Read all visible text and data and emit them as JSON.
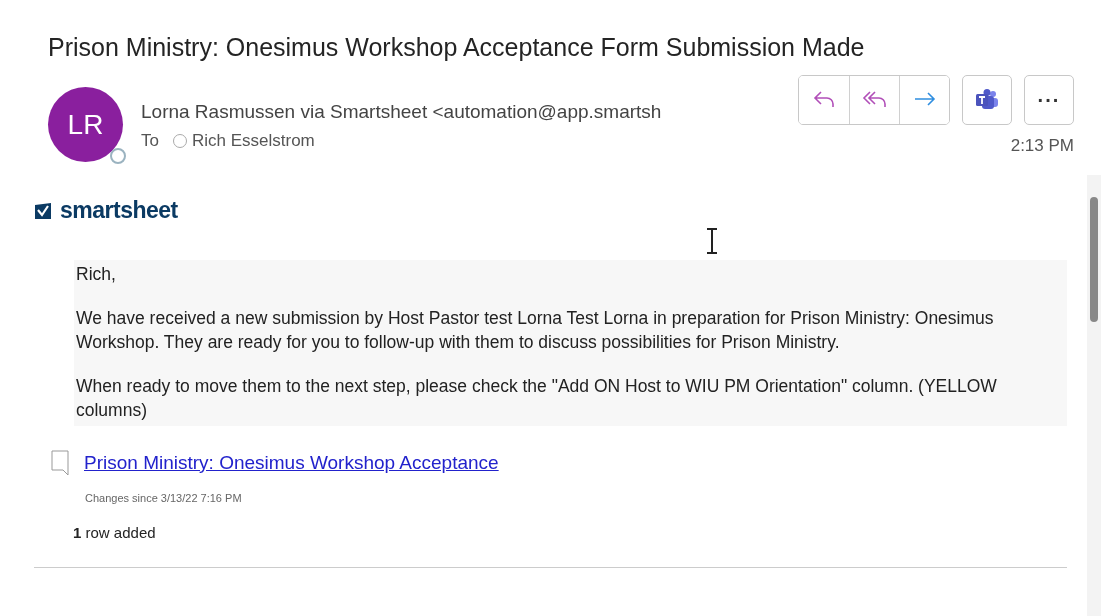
{
  "subject": "Prison Ministry: Onesimus Workshop Acceptance Form Submission Made",
  "sender": {
    "initials": "LR",
    "from": "Lorna Rasmussen via Smartsheet <automation@app.smartsh",
    "to_label": "To",
    "recipient": "Rich Esselstrom",
    "time": "2:13 PM"
  },
  "actions": [
    {
      "kind": "reply"
    },
    {
      "kind": "reply-all"
    },
    {
      "kind": "forward"
    }
  ],
  "extra_actions": [
    {
      "kind": "teams"
    },
    {
      "kind": "more",
      "label": "···"
    }
  ],
  "brand": "smartsheet",
  "message": [
    "Rich,",
    "We have received a new submission by Host Pastor test Lorna Test Lorna in preparation for Prison Ministry: Onesimus Workshop. They are ready for you to follow-up with them to discuss possibilities for Prison Ministry.",
    "When ready to move them to the next step, please check the \"Add ON Host to WIU PM Orientation\" column. (YELLOW columns)"
  ],
  "sheet_link": "Prison Ministry: Onesimus Workshop Acceptance",
  "changes": "Changes since 3/13/22 7:16 PM",
  "summary": "**1** row added"
}
